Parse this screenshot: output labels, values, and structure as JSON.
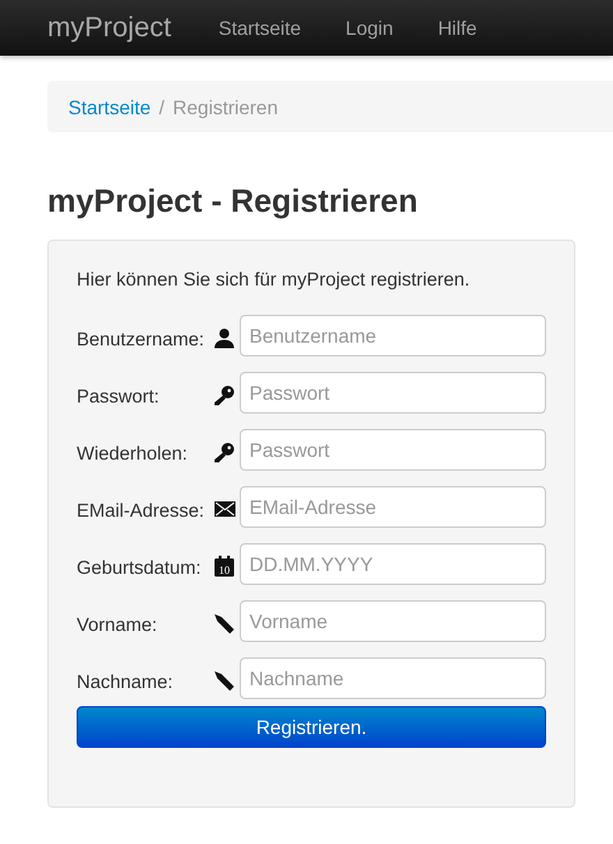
{
  "navbar": {
    "brand": "myProject",
    "links": [
      "Startseite",
      "Login",
      "Hilfe"
    ]
  },
  "breadcrumb": {
    "link": "Startseite",
    "separator": "/",
    "current": "Registrieren"
  },
  "heading": "myProject - Registrieren",
  "form": {
    "intro": "Hier können Sie sich für myProject registrieren.",
    "fields": [
      {
        "label": "Benutzername:",
        "kind": "user",
        "placeholder": "Benutzername"
      },
      {
        "label": "Passwort:",
        "kind": "key",
        "placeholder": "Passwort"
      },
      {
        "label": "Wiederholen:",
        "kind": "key",
        "placeholder": "Passwort"
      },
      {
        "label": "EMail-Adresse:",
        "kind": "envelope",
        "placeholder": "EMail-Adresse"
      },
      {
        "label": "Geburtsdatum:",
        "kind": "calendar",
        "icon_text": "10",
        "placeholder": "DD.MM.YYYY"
      },
      {
        "label": "Vorname:",
        "kind": "pencil",
        "placeholder": "Vorname"
      },
      {
        "label": "Nachname:",
        "kind": "pencil",
        "placeholder": "Nachname"
      }
    ],
    "submit": "Registrieren."
  }
}
